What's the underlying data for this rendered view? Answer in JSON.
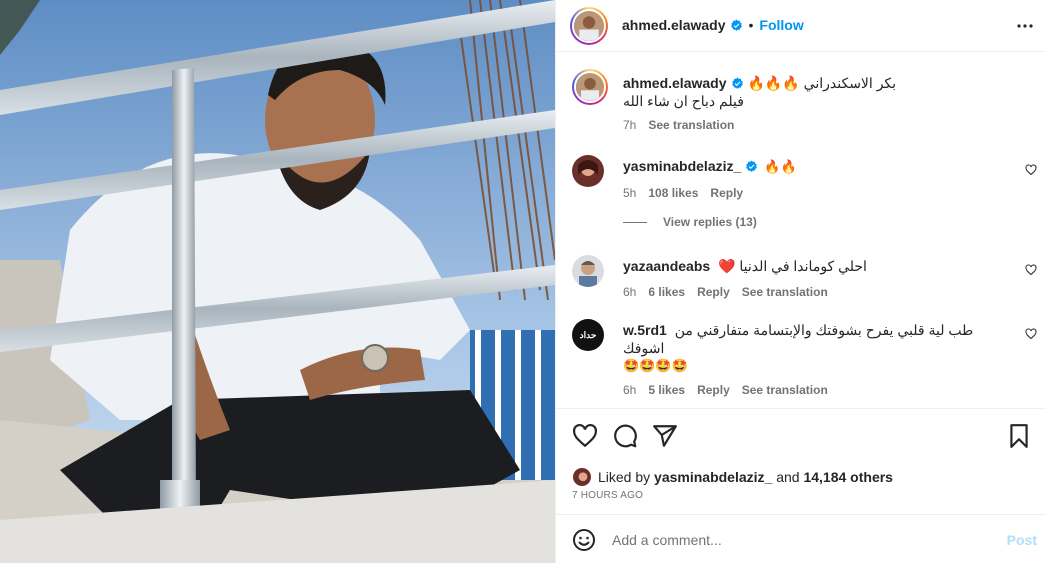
{
  "header": {
    "username": "ahmed.elawady",
    "separator": "•",
    "follow_label": "Follow",
    "more_icon": "more-horizontal-icon"
  },
  "caption": {
    "username": "ahmed.elawady",
    "line1": "بكر الاسكندراني 🔥🔥🔥",
    "line2": "فيلم دباح ان شاء الله",
    "time": "7h",
    "see_translation": "See translation"
  },
  "comments": [
    {
      "username": "yasminabdelaziz_",
      "verified": true,
      "text": "🔥🔥",
      "time": "5h",
      "likes": "108 likes",
      "reply": "Reply",
      "view_replies": "View replies (13)"
    },
    {
      "username": "yazaandeabs",
      "verified": false,
      "text": "احلي كوماندا في الدنيا ❤️",
      "time": "6h",
      "likes": "6 likes",
      "reply": "Reply",
      "see_translation": "See translation"
    },
    {
      "username": "w.5rd1",
      "verified": false,
      "text": "طب لية قلبي يفرح بشوفتك والإبتسامة متفارقني من اشوفك",
      "text2": "🤩🤩🤩🤩",
      "time": "6h",
      "likes": "5 likes",
      "reply": "Reply",
      "see_translation": "See translation",
      "avatar_text": "حداد"
    }
  ],
  "likes": {
    "prefix": "Liked by",
    "user": "yasminabdelaziz_",
    "and": "and",
    "others": "14,184 others"
  },
  "time_ago": "7 HOURS AGO",
  "add_comment": {
    "placeholder": "Add a comment...",
    "post_label": "Post"
  },
  "colors": {
    "accent": "#0095f6",
    "text": "#262626",
    "muted": "#737373",
    "post_disabled": "#b2dffc"
  }
}
